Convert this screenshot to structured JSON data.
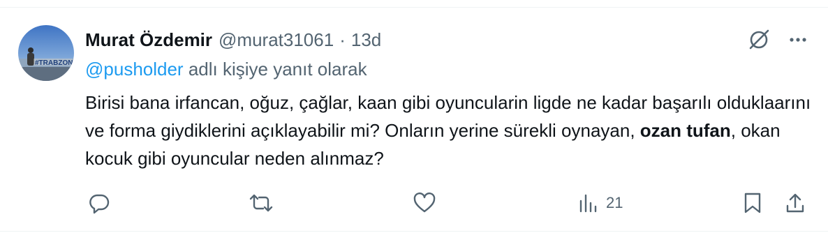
{
  "tweet": {
    "author_name": "Murat Özdemir",
    "author_handle": "@murat31061",
    "separator": "·",
    "time": "13d",
    "reply_prefix_mention": "@pusholder",
    "reply_suffix": " adlı kişiye yanıt olarak",
    "body_part1": "Birisi bana irfancan, oğuz, çağlar, kaan gibi oyuncularin ligde ne kadar başarılı olduklaarını ve forma giydiklerini açıklayabilir mi? Onların yerine sürekli oynayan, ",
    "body_bold": "ozan tufan",
    "body_part2": ", okan kocuk gibi oyuncular neden alınmaz?",
    "avatar_text": "#TRABZON",
    "views_count": "21"
  },
  "icons": {
    "grok": "grok-icon",
    "more": "more-icon",
    "reply": "reply-icon",
    "retweet": "retweet-icon",
    "like": "like-icon",
    "views": "views-icon",
    "bookmark": "bookmark-icon",
    "share": "share-icon"
  },
  "colors": {
    "text_primary": "#0f1419",
    "text_secondary": "#536471",
    "link": "#1d9bf0",
    "divider": "#eff3f4"
  }
}
